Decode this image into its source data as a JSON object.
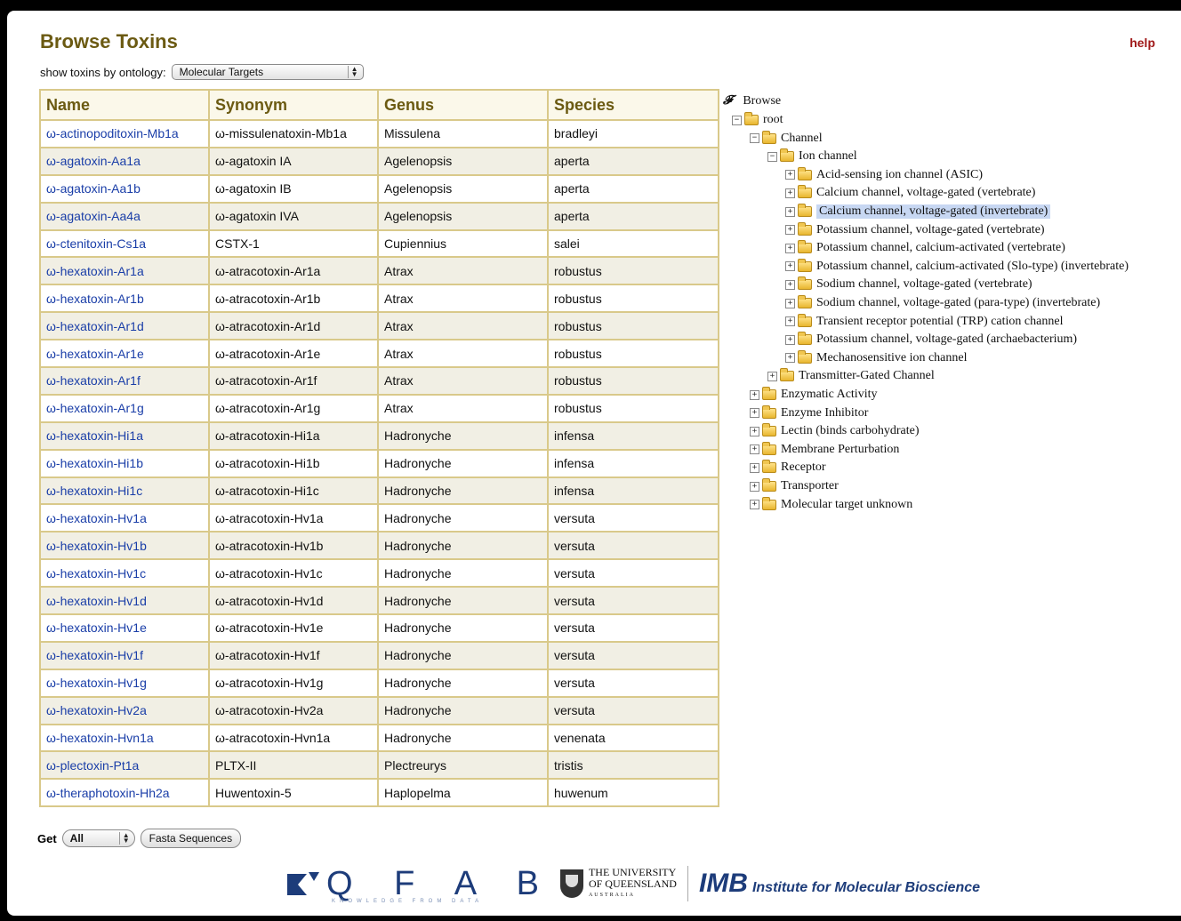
{
  "header": {
    "title": "Browse Toxins",
    "help_label": "help",
    "ontology_label": "show toxins by ontology:",
    "ontology_selected": "Molecular Targets"
  },
  "table": {
    "columns": [
      "Name",
      "Synonym",
      "Genus",
      "Species"
    ],
    "rows": [
      [
        "ω-actinopoditoxin-Mb1a",
        "ω-missulenatoxin-Mb1a",
        "Missulena",
        "bradleyi"
      ],
      [
        "ω-agatoxin-Aa1a",
        "ω-agatoxin IA",
        "Agelenopsis",
        "aperta"
      ],
      [
        "ω-agatoxin-Aa1b",
        "ω-agatoxin IB",
        "Agelenopsis",
        "aperta"
      ],
      [
        "ω-agatoxin-Aa4a",
        "ω-agatoxin IVA",
        "Agelenopsis",
        "aperta"
      ],
      [
        "ω-ctenitoxin-Cs1a",
        "CSTX-1",
        "Cupiennius",
        "salei"
      ],
      [
        "ω-hexatoxin-Ar1a",
        "ω-atracotoxin-Ar1a",
        "Atrax",
        "robustus"
      ],
      [
        "ω-hexatoxin-Ar1b",
        "ω-atracotoxin-Ar1b",
        "Atrax",
        "robustus"
      ],
      [
        "ω-hexatoxin-Ar1d",
        "ω-atracotoxin-Ar1d",
        "Atrax",
        "robustus"
      ],
      [
        "ω-hexatoxin-Ar1e",
        "ω-atracotoxin-Ar1e",
        "Atrax",
        "robustus"
      ],
      [
        "ω-hexatoxin-Ar1f",
        "ω-atracotoxin-Ar1f",
        "Atrax",
        "robustus"
      ],
      [
        "ω-hexatoxin-Ar1g",
        "ω-atracotoxin-Ar1g",
        "Atrax",
        "robustus"
      ],
      [
        "ω-hexatoxin-Hi1a",
        "ω-atracotoxin-Hi1a",
        "Hadronyche",
        "infensa"
      ],
      [
        "ω-hexatoxin-Hi1b",
        "ω-atracotoxin-Hi1b",
        "Hadronyche",
        "infensa"
      ],
      [
        "ω-hexatoxin-Hi1c",
        "ω-atracotoxin-Hi1c",
        "Hadronyche",
        "infensa"
      ],
      [
        "ω-hexatoxin-Hv1a",
        "ω-atracotoxin-Hv1a",
        "Hadronyche",
        "versuta"
      ],
      [
        "ω-hexatoxin-Hv1b",
        "ω-atracotoxin-Hv1b",
        "Hadronyche",
        "versuta"
      ],
      [
        "ω-hexatoxin-Hv1c",
        "ω-atracotoxin-Hv1c",
        "Hadronyche",
        "versuta"
      ],
      [
        "ω-hexatoxin-Hv1d",
        "ω-atracotoxin-Hv1d",
        "Hadronyche",
        "versuta"
      ],
      [
        "ω-hexatoxin-Hv1e",
        "ω-atracotoxin-Hv1e",
        "Hadronyche",
        "versuta"
      ],
      [
        "ω-hexatoxin-Hv1f",
        "ω-atracotoxin-Hv1f",
        "Hadronyche",
        "versuta"
      ],
      [
        "ω-hexatoxin-Hv1g",
        "ω-atracotoxin-Hv1g",
        "Hadronyche",
        "versuta"
      ],
      [
        "ω-hexatoxin-Hv2a",
        "ω-atracotoxin-Hv2a",
        "Hadronyche",
        "versuta"
      ],
      [
        "ω-hexatoxin-Hvn1a",
        "ω-atracotoxin-Hvn1a",
        "Hadronyche",
        "venenata"
      ],
      [
        "ω-plectoxin-Pt1a",
        "PLTX-II",
        "Plectreurys",
        "tristis"
      ],
      [
        "ω-theraphotoxin-Hh2a",
        "Huwentoxin-5",
        "Haplopelma",
        "huwenum"
      ]
    ]
  },
  "tree": {
    "browse_label": "Browse",
    "nodes": [
      {
        "label": "root",
        "level": 0,
        "toggle": "⊟",
        "selected": false
      },
      {
        "label": "Channel",
        "level": 1,
        "toggle": "⊟",
        "selected": false
      },
      {
        "label": "Ion channel",
        "level": 2,
        "toggle": "⊟",
        "selected": false
      },
      {
        "label": "Acid-sensing ion channel (ASIC)",
        "level": 3,
        "toggle": "⊞",
        "selected": false
      },
      {
        "label": "Calcium channel, voltage-gated (vertebrate)",
        "level": 3,
        "toggle": "⊞",
        "selected": false
      },
      {
        "label": "Calcium channel, voltage-gated (invertebrate)",
        "level": 3,
        "toggle": "⊞",
        "selected": true
      },
      {
        "label": "Potassium channel, voltage-gated (vertebrate)",
        "level": 3,
        "toggle": "⊞",
        "selected": false
      },
      {
        "label": "Potassium channel, calcium-activated (vertebrate)",
        "level": 3,
        "toggle": "⊞",
        "selected": false
      },
      {
        "label": "Potassium channel, calcium-activated (Slo-type) (invertebrate)",
        "level": 3,
        "toggle": "⊞",
        "selected": false
      },
      {
        "label": "Sodium channel, voltage-gated (vertebrate)",
        "level": 3,
        "toggle": "⊞",
        "selected": false
      },
      {
        "label": "Sodium channel, voltage-gated (para-type) (invertebrate)",
        "level": 3,
        "toggle": "⊞",
        "selected": false
      },
      {
        "label": "Transient receptor potential (TRP) cation channel",
        "level": 3,
        "toggle": "⊞",
        "selected": false
      },
      {
        "label": "Potassium channel, voltage-gated (archaebacterium)",
        "level": 3,
        "toggle": "⊞",
        "selected": false
      },
      {
        "label": "Mechanosensitive ion channel",
        "level": 3,
        "toggle": "⊞",
        "selected": false
      },
      {
        "label": "Transmitter-Gated Channel",
        "level": 2,
        "toggle": "⊞",
        "selected": false
      },
      {
        "label": "Enzymatic Activity",
        "level": 1,
        "toggle": "⊞",
        "selected": false
      },
      {
        "label": "Enzyme Inhibitor",
        "level": 1,
        "toggle": "⊞",
        "selected": false
      },
      {
        "label": "Lectin (binds carbohydrate)",
        "level": 1,
        "toggle": "⊞",
        "selected": false
      },
      {
        "label": "Membrane Perturbation",
        "level": 1,
        "toggle": "⊞",
        "selected": false
      },
      {
        "label": "Receptor",
        "level": 1,
        "toggle": "⊞",
        "selected": false
      },
      {
        "label": "Transporter",
        "level": 1,
        "toggle": "⊞",
        "selected": false
      },
      {
        "label": "Molecular target unknown",
        "level": 1,
        "toggle": "⊞",
        "selected": false
      }
    ]
  },
  "footer_controls": {
    "get_label": "Get",
    "get_selected": "All",
    "fasta_label": "Fasta Sequences"
  },
  "logos": {
    "qfab": "Q F A B",
    "qfab_tagline": "KNOWLEDGE FROM DATA",
    "uq_line1": "THE UNIVERSITY",
    "uq_line2": "OF QUEENSLAND",
    "uq_line3": "AUSTRALIA",
    "imb_short": "IMB",
    "imb_full": "Institute for Molecular Bioscience"
  },
  "colors": {
    "title": "#6b5a12",
    "link": "#1a3ea8",
    "help": "#a01818",
    "table_border": "#d9c98a",
    "row_alt": "#f1efe4",
    "tree_selected": "#c7d7f2"
  }
}
